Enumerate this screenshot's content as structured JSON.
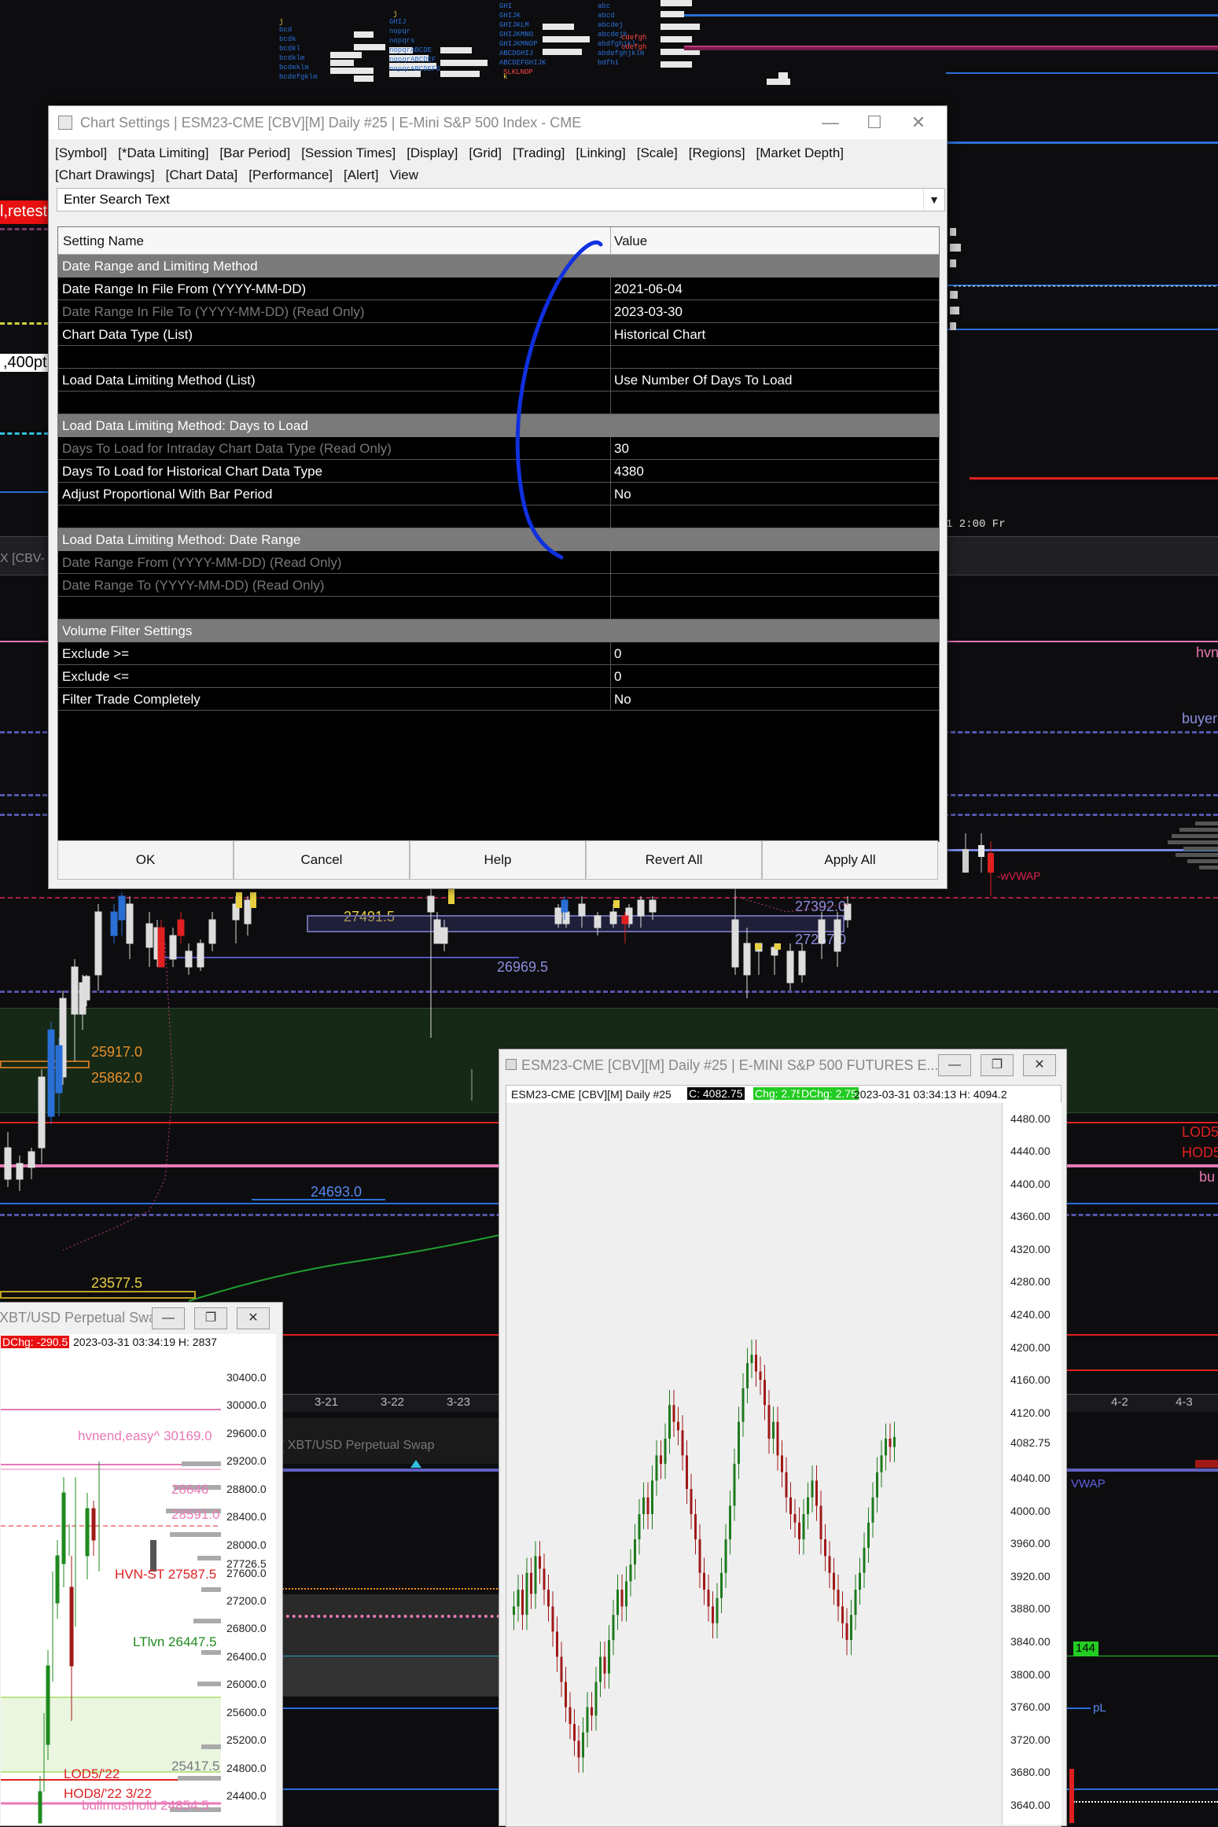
{
  "dialog": {
    "title": "Chart Settings | ESM23-CME [CBV][M]  Daily  #25 | E-Mini S&P 500 Index - CME",
    "menu_row1": [
      "[Symbol]",
      "[*Data Limiting]",
      "[Bar Period]",
      "[Session Times]",
      "[Display]",
      "[Grid]",
      "[Trading]",
      "[Linking]",
      "[Scale]",
      "[Regions]",
      "[Market Depth]"
    ],
    "menu_row2": [
      "[Chart Drawings]",
      "[Chart Data]",
      "[Performance]",
      "[Alert]",
      "View"
    ],
    "search_placeholder": "Enter Search Text",
    "header": {
      "name": "Setting Name",
      "value": "Value"
    },
    "rows": [
      {
        "type": "section",
        "name": "Date Range and Limiting Method"
      },
      {
        "type": "row",
        "name": "Date Range In File From (YYYY-MM-DD)",
        "value": "2021-06-04"
      },
      {
        "type": "ro",
        "name": "Date Range In File To (YYYY-MM-DD) (Read Only)",
        "value": "2023-03-30"
      },
      {
        "type": "row",
        "name": "Chart Data Type (List)",
        "value": "Historical Chart"
      },
      {
        "type": "blank",
        "name": "",
        "value": ""
      },
      {
        "type": "row",
        "name": "Load Data Limiting Method (List)",
        "value": "Use Number Of Days To Load"
      },
      {
        "type": "blank",
        "name": "",
        "value": ""
      },
      {
        "type": "section",
        "name": "Load Data Limiting Method: Days to Load"
      },
      {
        "type": "ro",
        "name": "Days To Load for Intraday Chart Data Type (Read Only)",
        "value": "30"
      },
      {
        "type": "row",
        "name": "Days To Load for Historical Chart Data Type",
        "value": "4380"
      },
      {
        "type": "row",
        "name": "Adjust Proportional With Bar Period",
        "value": "No"
      },
      {
        "type": "blank",
        "name": "",
        "value": ""
      },
      {
        "type": "section",
        "name": "Load Data Limiting Method: Date Range"
      },
      {
        "type": "rov",
        "name": "Date Range From (YYYY-MM-DD) (Read Only)",
        "value": ""
      },
      {
        "type": "rov",
        "name": "Date Range To (YYYY-MM-DD) (Read Only)",
        "value": ""
      },
      {
        "type": "blank",
        "name": "",
        "value": ""
      },
      {
        "type": "section",
        "name": "Volume Filter Settings"
      },
      {
        "type": "row",
        "name": "Exclude >=",
        "value": "0"
      },
      {
        "type": "row",
        "name": "Exclude <=",
        "value": "0"
      },
      {
        "type": "row",
        "name": "Filter Trade Completely",
        "value": "No"
      }
    ],
    "buttons": [
      "OK",
      "Cancel",
      "Help",
      "Revert All",
      "Apply All"
    ]
  },
  "bg_chart": {
    "price_labels": [
      "27491.5",
      "26969.5",
      "25917.0",
      "25862.0",
      "24693.0",
      "23577.5",
      "27392.0",
      "27257.0"
    ],
    "left_labels": [
      "l,retest",
      ",400pt"
    ],
    "right_labels": [
      "hvn",
      "buyer",
      "LOD5",
      "HOD5",
      "bu",
      "-wVWAP",
      "1  2:00 Fr"
    ],
    "date_labels": [
      "3-21",
      "3-22",
      "3-23",
      "4-2",
      "4-3"
    ],
    "mid_title": "( XBT/USD Perpetual Swap",
    "right_misc": [
      "VWAP",
      "144",
      "pL"
    ],
    "colors": {
      "background": "#0d0d0f",
      "green_zone": "#162816",
      "pink": "#e879b6",
      "red": "#e02020",
      "blue": "#2a6fd6",
      "dash_blue": "#5555aa"
    }
  },
  "btc_window": {
    "title": "XBT/USD Perpetual Swap",
    "info": [
      "DChg: -290.5",
      "2023-03-31 03:34:19 H: 2837"
    ],
    "axis": [
      "30400.0",
      "30000.0",
      "29600.0",
      "29200.0",
      "28800.0",
      "28400.0",
      "28000.0",
      "27726.5",
      "27600.0",
      "27200.0",
      "26800.0",
      "26400.0",
      "26000.0",
      "25600.0",
      "25200.0",
      "24800.0",
      "24400.0"
    ],
    "levels": [
      "hvnend,easy^  30169.0",
      "28646",
      "28591.0",
      "HVN-ST  27587.5",
      "LTlvn  26447.5",
      "25417.5",
      "LOD5/'22",
      "HOD8/'22 3/22",
      "bullmusthold  24854.5"
    ]
  },
  "es_window": {
    "title": "ESM23-CME [CBV][M]  Daily  #25 | E-MINI S&P 500 FUTURES E...",
    "info": {
      "symbol": "ESM23-CME [CBV][M]  Daily  #25",
      "close": "C: 4082.75",
      "chg": "Chg: 2.75",
      "dchg": "DChg: 2.75",
      "time": "2023-03-31 03:34:13 H: 4094.2"
    },
    "axis": [
      "4480.00",
      "4440.00",
      "4400.00",
      "4360.00",
      "4320.00",
      "4280.00",
      "4240.00",
      "4200.00",
      "4160.00",
      "4120.00",
      "4082.75",
      "4040.00",
      "4000.00",
      "3960.00",
      "3920.00",
      "3880.00",
      "3840.00",
      "3800.00",
      "3760.00",
      "3720.00",
      "3680.00",
      "3640.00"
    ],
    "colors": {
      "up": "#1e7a1e",
      "down": "#a01818",
      "close_badge": "#000000",
      "chg_badge": "#22cc22"
    }
  }
}
